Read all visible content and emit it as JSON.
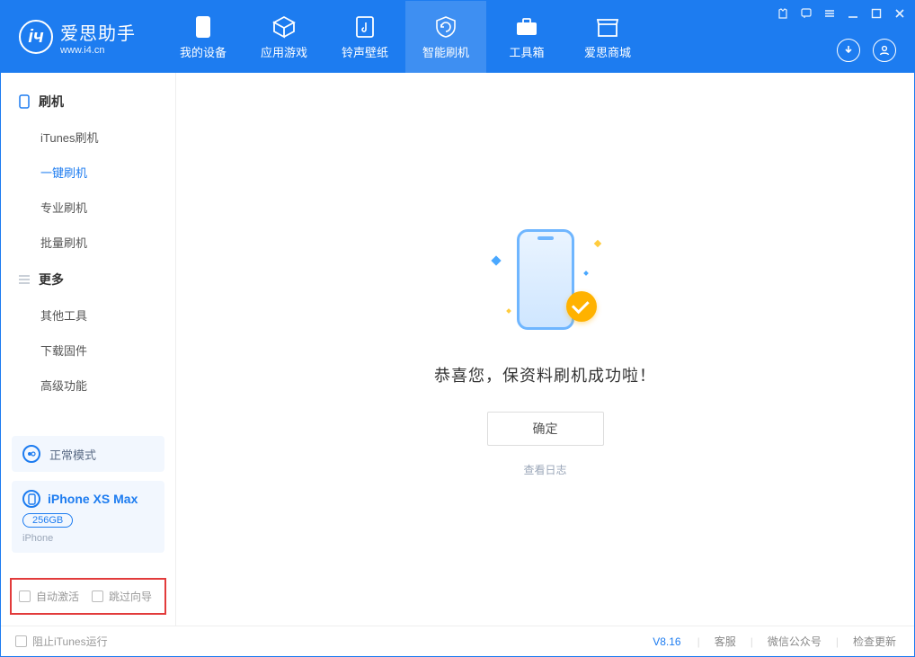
{
  "app": {
    "name_cn": "爱思助手",
    "url": "www.i4.cn"
  },
  "nav": {
    "items": [
      {
        "label": "我的设备"
      },
      {
        "label": "应用游戏"
      },
      {
        "label": "铃声壁纸"
      },
      {
        "label": "智能刷机"
      },
      {
        "label": "工具箱"
      },
      {
        "label": "爱思商城"
      }
    ],
    "active_index": 3
  },
  "sidebar": {
    "group1_title": "刷机",
    "group1_items": [
      "iTunes刷机",
      "一键刷机",
      "专业刷机",
      "批量刷机"
    ],
    "group1_active_index": 1,
    "group2_title": "更多",
    "group2_items": [
      "其他工具",
      "下载固件",
      "高级功能"
    ],
    "mode_label": "正常模式",
    "device_name": "iPhone XS Max",
    "device_capacity": "256GB",
    "device_type": "iPhone",
    "checkbox_auto_activate": "自动激活",
    "checkbox_skip_guide": "跳过向导"
  },
  "main": {
    "success_text": "恭喜您，保资料刷机成功啦！",
    "ok_button": "确定",
    "view_log": "查看日志"
  },
  "statusbar": {
    "block_itunes": "阻止iTunes运行",
    "version": "V8.16",
    "links": [
      "客服",
      "微信公众号",
      "检查更新"
    ]
  }
}
